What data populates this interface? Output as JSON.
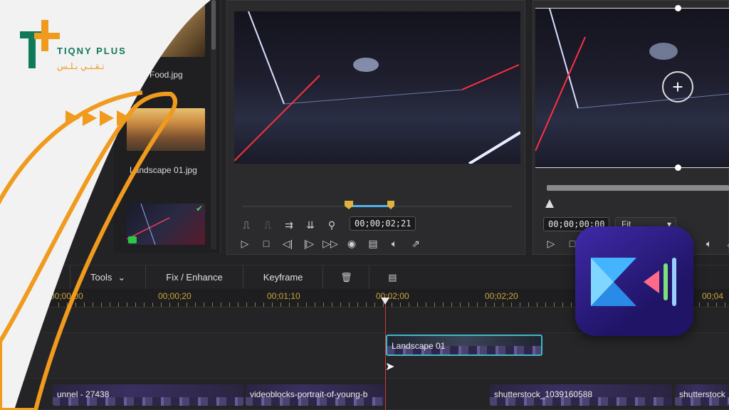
{
  "branding": {
    "name_en": "TIQNY PLUS",
    "name_ar": "تـقـنـي بـلـس",
    "accent_orange": "#f09a1e",
    "accent_green": "#0f7a5a"
  },
  "media_library": {
    "items": [
      {
        "label": "Food.jpg"
      },
      {
        "label": "Landscape 01.jpg"
      },
      {
        "label": ""
      }
    ]
  },
  "preview_left": {
    "timecode": "00;00;02;21"
  },
  "preview_right": {
    "timecode": "00;00;00;00",
    "fit_label": "Fit"
  },
  "toolbar": {
    "tools_label": "Tools",
    "fix_label": "Fix / Enhance",
    "keyframe_label": "Keyframe"
  },
  "timeline": {
    "ruler_labels": [
      "00;00;00",
      "00;00;20",
      "00;01;10",
      "00;02;00",
      "00;02;20",
      "00;04"
    ],
    "clips": {
      "selected": "Landscape 01",
      "bottom": [
        "unnel - 27438",
        "videoblocks-portrait-of-young-b",
        "shutterstock_1039160588",
        "shutterstock"
      ]
    }
  },
  "colors": {
    "playhead": "#d23a3a",
    "ruler_text": "#c9a53b",
    "clip_selected_border": "#3fb7c9"
  }
}
